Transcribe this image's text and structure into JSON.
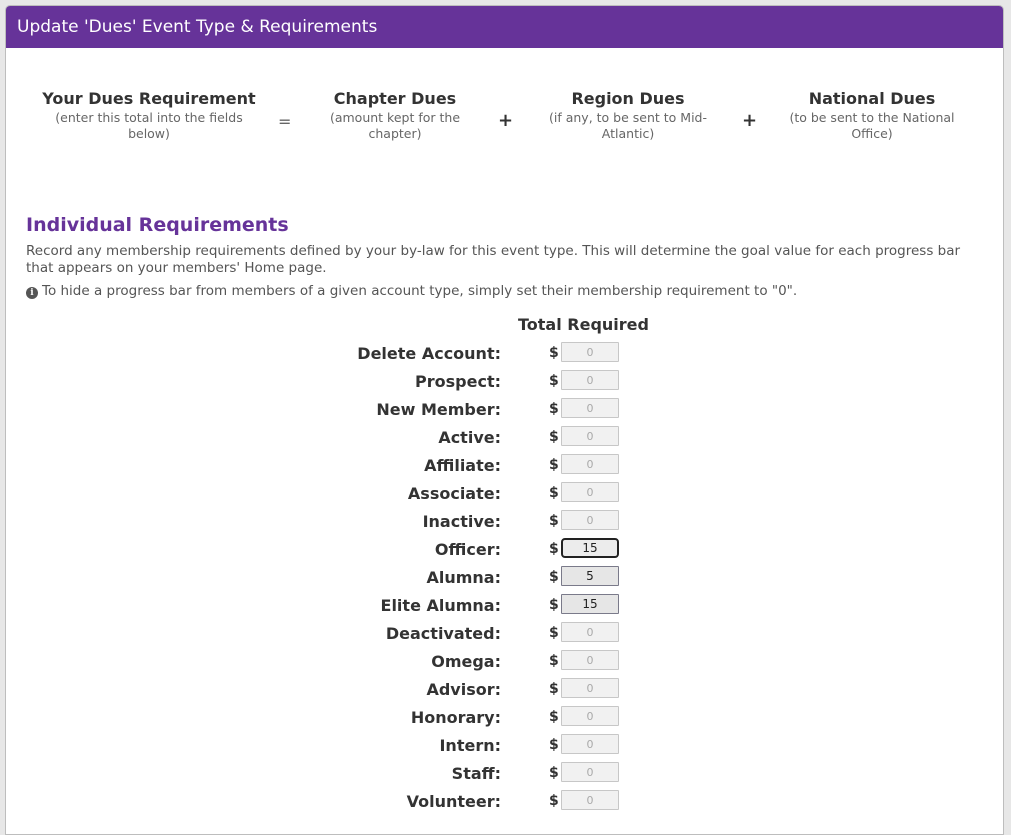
{
  "modal": {
    "title": "Update 'Dues' Event Type & Requirements"
  },
  "equation": {
    "your_dues": {
      "title": "Your Dues Requirement",
      "sub": "(enter this total into the fields below)"
    },
    "equals": "=",
    "chapter_dues": {
      "title": "Chapter Dues",
      "sub": "(amount kept for the chapter)"
    },
    "plus1": "+",
    "region_dues": {
      "title": "Region Dues",
      "sub": "(if any, to be sent to Mid-Atlantic)"
    },
    "plus2": "+",
    "national_dues": {
      "title": "National Dues",
      "sub": "(to be sent to the National Office)"
    }
  },
  "individual": {
    "title": "Individual Requirements",
    "description": "Record any membership requirements defined by your by-law for this event type. This will determine the goal value for each progress bar that appears on your members' Home page.",
    "note": "To hide a progress bar from members of a given account type, simply set their membership requirement to \"0\".",
    "column_header": "Total Required",
    "currency": "$",
    "rows": [
      {
        "label": "Delete Account:",
        "value": "0"
      },
      {
        "label": "Prospect:",
        "value": "0"
      },
      {
        "label": "New Member:",
        "value": "0"
      },
      {
        "label": "Active:",
        "value": "0"
      },
      {
        "label": "Affiliate:",
        "value": "0"
      },
      {
        "label": "Associate:",
        "value": "0"
      },
      {
        "label": "Inactive:",
        "value": "0"
      },
      {
        "label": "Officer:",
        "value": "15"
      },
      {
        "label": "Alumna:",
        "value": "5"
      },
      {
        "label": "Elite Alumna:",
        "value": "15"
      },
      {
        "label": "Deactivated:",
        "value": "0"
      },
      {
        "label": "Omega:",
        "value": "0"
      },
      {
        "label": "Advisor:",
        "value": "0"
      },
      {
        "label": "Honorary:",
        "value": "0"
      },
      {
        "label": "Intern:",
        "value": "0"
      },
      {
        "label": "Staff:",
        "value": "0"
      },
      {
        "label": "Volunteer:",
        "value": "0"
      }
    ]
  },
  "colors": {
    "header_bg": "#663399",
    "accent": "#663399"
  }
}
